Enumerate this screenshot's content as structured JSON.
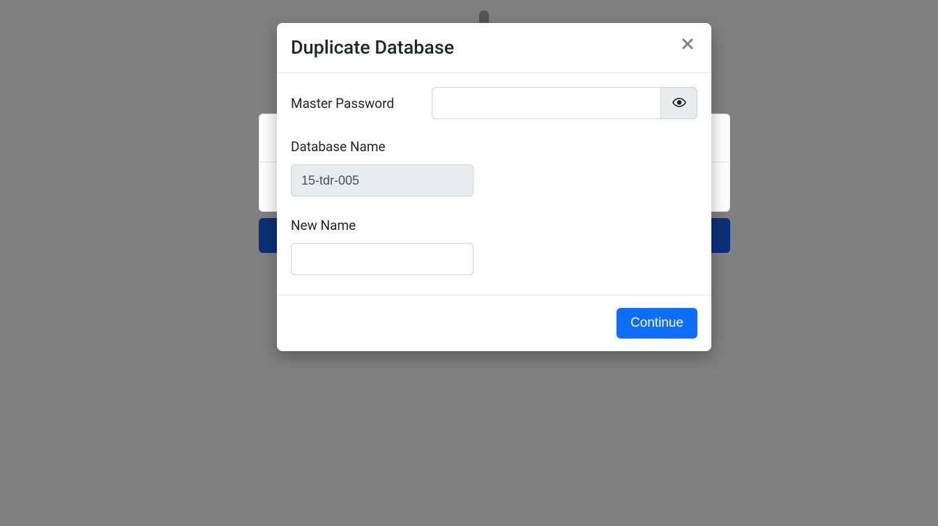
{
  "modal": {
    "title": "Duplicate Database",
    "masterPassword": {
      "label": "Master Password",
      "value": ""
    },
    "databaseName": {
      "label": "Database Name",
      "value": "15-tdr-005"
    },
    "newName": {
      "label": "New Name",
      "value": ""
    },
    "continueLabel": "Continue"
  }
}
